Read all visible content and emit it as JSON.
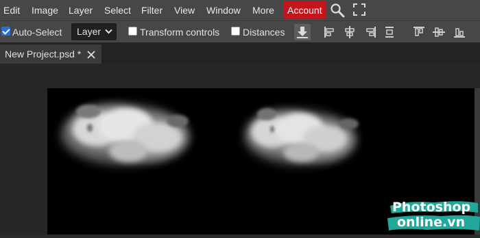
{
  "menubar": {
    "items": [
      "Edit",
      "Image",
      "Layer",
      "Select",
      "Filter",
      "View",
      "Window",
      "More"
    ],
    "account_label": "Account",
    "icons": [
      "search-icon",
      "fullscreen-icon"
    ]
  },
  "options": {
    "auto_select_label": "Auto-Select",
    "auto_select_checked": true,
    "layer_select_value": "Layer",
    "transform_controls_label": "Transform controls",
    "transform_controls_checked": false,
    "distances_label": "Distances",
    "distances_checked": false,
    "align_icons": [
      "align-left-icon",
      "align-center-icon",
      "align-right-icon",
      "distribute-horizontal-icon",
      "align-top-icon",
      "align-middle-icon",
      "align-bottom-icon"
    ]
  },
  "document": {
    "tab_title": "New Project.psd *"
  },
  "watermark": {
    "line1": "Photoshop",
    "line2": "online.vn",
    "accent_color": "#21a89a"
  },
  "colors": {
    "menubar": "#474747",
    "account": "#c4151c",
    "canvas": "#000000"
  }
}
